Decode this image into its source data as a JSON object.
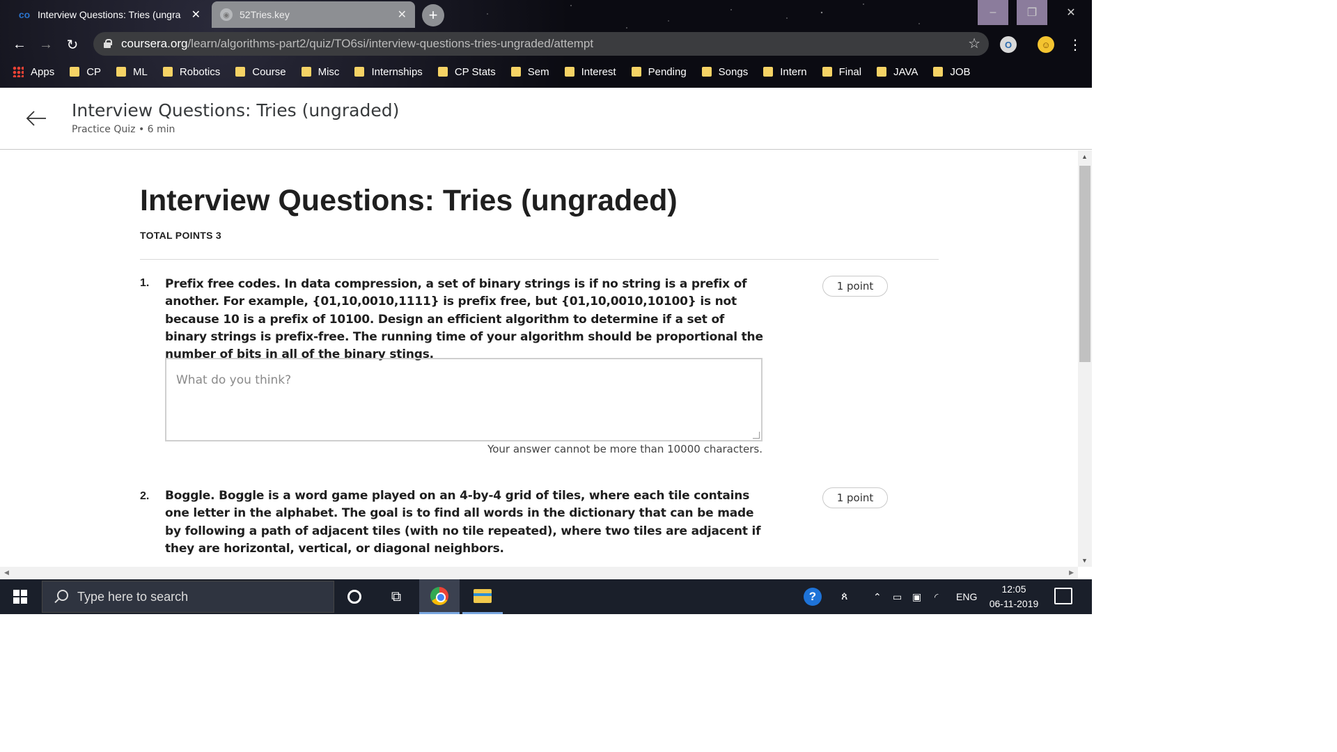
{
  "browser": {
    "tabs": [
      {
        "title": "Interview Questions: Tries (ungra",
        "favicon": "coursera-icon"
      },
      {
        "title": "52Tries.key",
        "favicon": "globe-icon"
      }
    ],
    "url_host": "coursera.org",
    "url_path": "/learn/algorithms-part2/quiz/TO6si/interview-questions-tries-ungraded/attempt",
    "bookmarks": [
      "Apps",
      "CP",
      "ML",
      "Robotics",
      "Course",
      "Misc",
      "Internships",
      "CP Stats",
      "Sem",
      "Interest",
      "Pending",
      "Songs",
      "Intern",
      "Final",
      "JAVA",
      "JOB"
    ]
  },
  "header": {
    "title": "Interview Questions: Tries (ungraded)",
    "subtitle": "Practice Quiz • 6 min"
  },
  "quiz": {
    "title": "Interview Questions: Tries (ungraded)",
    "total_points": "TOTAL POINTS 3",
    "questions": [
      {
        "number": "1.",
        "text": "Prefix free codes. In data compression, a set of binary strings is if no string is a prefix of another. For example, {01,10,0010,1111} is prefix free, but {01,10,0010,10100} is not because 10 is a prefix of 10100. Design an efficient algorithm to determine if a set of binary strings is prefix-free. The running time of your algorithm should be proportional the number of bits in all of the binary stings.",
        "points": "1 point",
        "answer_placeholder": "What do you think?",
        "hint": "Your answer cannot be more than 10000 characters."
      },
      {
        "number": "2.",
        "text": "Boggle. Boggle is a word game played on an 4-by-4 grid of tiles, where each tile contains one letter in the alphabet. The goal is to find all words in the dictionary that can be made by following a path of adjacent tiles (with no tile repeated), where two tiles are adjacent if they are horizontal, vertical, or diagonal neighbors.",
        "points": "1 point"
      }
    ]
  },
  "taskbar": {
    "search_placeholder": "Type here to search",
    "language": "ENG",
    "time": "12:05",
    "date": "06-11-2019"
  }
}
